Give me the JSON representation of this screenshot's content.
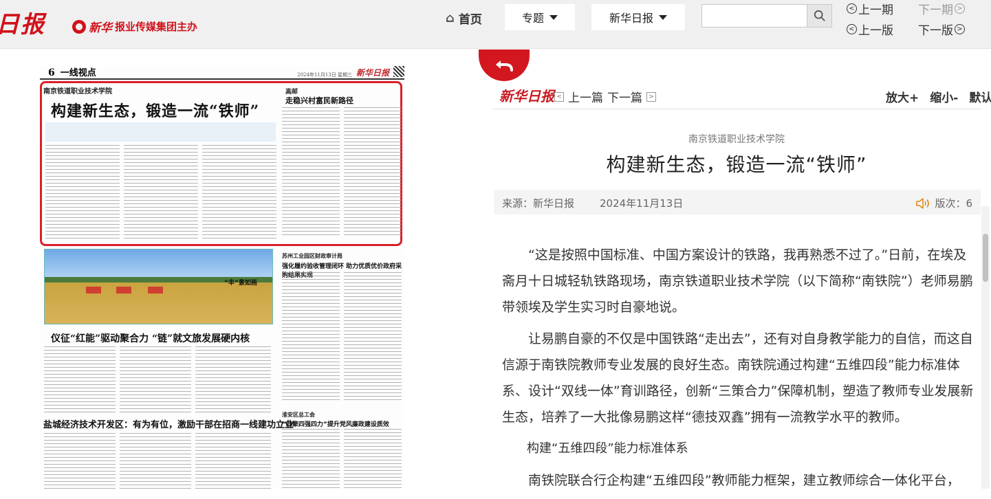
{
  "header": {
    "logo_text": "日报",
    "group_brand": "新华",
    "group_text": "报业传媒集团主办",
    "home_label": "首页",
    "topic_label": "专题",
    "paper_label": "新华日报",
    "search": {
      "value": "",
      "placeholder": ""
    },
    "prev_issue": "上一期",
    "next_issue": "下一期",
    "prev_page": "上一版",
    "next_page": "下一版"
  },
  "newspaper": {
    "page_no": "6",
    "section": "一线视点",
    "date": "2024年11月13日 星期三",
    "brand": "新华日报",
    "articles": [
      {
        "label": "南京铁道职业技术学院",
        "title": "构建新生态，锻造一流“铁师”"
      },
      {
        "label": "高邮",
        "title": "走稳兴村富民新路径"
      },
      {
        "label": "",
        "title": "“丰”景如画"
      },
      {
        "label": "苏州工业园区财政审计局",
        "title": "强化履约验收管理闭环 助力优质优价政府采购结果实现"
      },
      {
        "label": "",
        "title": "仪征“红能”驱动聚合力 “链”就文旅发展硬内核"
      },
      {
        "label": "",
        "title": "盐城经济技术开发区：有为有位，激励干部在招商一线建功立业"
      },
      {
        "label": "淮安区总工会",
        "title": "“四聚四强四力”提升党风廉政建设质效"
      }
    ]
  },
  "reader": {
    "logo": "新华日报",
    "prev_article": "上一篇",
    "next_article": "下一篇",
    "zoom_in": "放大+",
    "zoom_out": "缩小-",
    "reset": "默认",
    "school": "南京铁道职业技术学院",
    "title": "构建新生态，锻造一流“铁师”",
    "source": "来源：新华日报",
    "date": "2024年11月13日",
    "version": "版次：6",
    "paragraphs": [
      "“这是按照中国标准、中国方案设计的铁路，我再熟悉不过了。”日前，在埃及斋月十日城轻轨铁路现场，南京铁道职业技术学院（以下简称“南铁院”）老师易鹏带领埃及学生实习时自豪地说。",
      "让易鹏自豪的不仅是中国铁路“走出去”，还有对自身教学能力的自信，而这自信源于南铁院教师专业发展的良好生态。南铁院通过构建“五维四段”能力标准体系、设计“双线一体”育训路径，创新“三策合力”保障机制，塑造了教师专业发展新生态，培养了一大批像易鹏这样“德技双鑫”拥有一流教学水平的教师。"
    ],
    "subheading": "构建“五维四段”能力标准体系",
    "paragraph3": "南铁院联合行企构建“五维四段”教师能力框架，建立教师综合一体化平台，"
  },
  "colors": {
    "brand_red": "#d0121b",
    "highlight_red": "#d8202a",
    "accent_orange": "#e08a1e"
  }
}
